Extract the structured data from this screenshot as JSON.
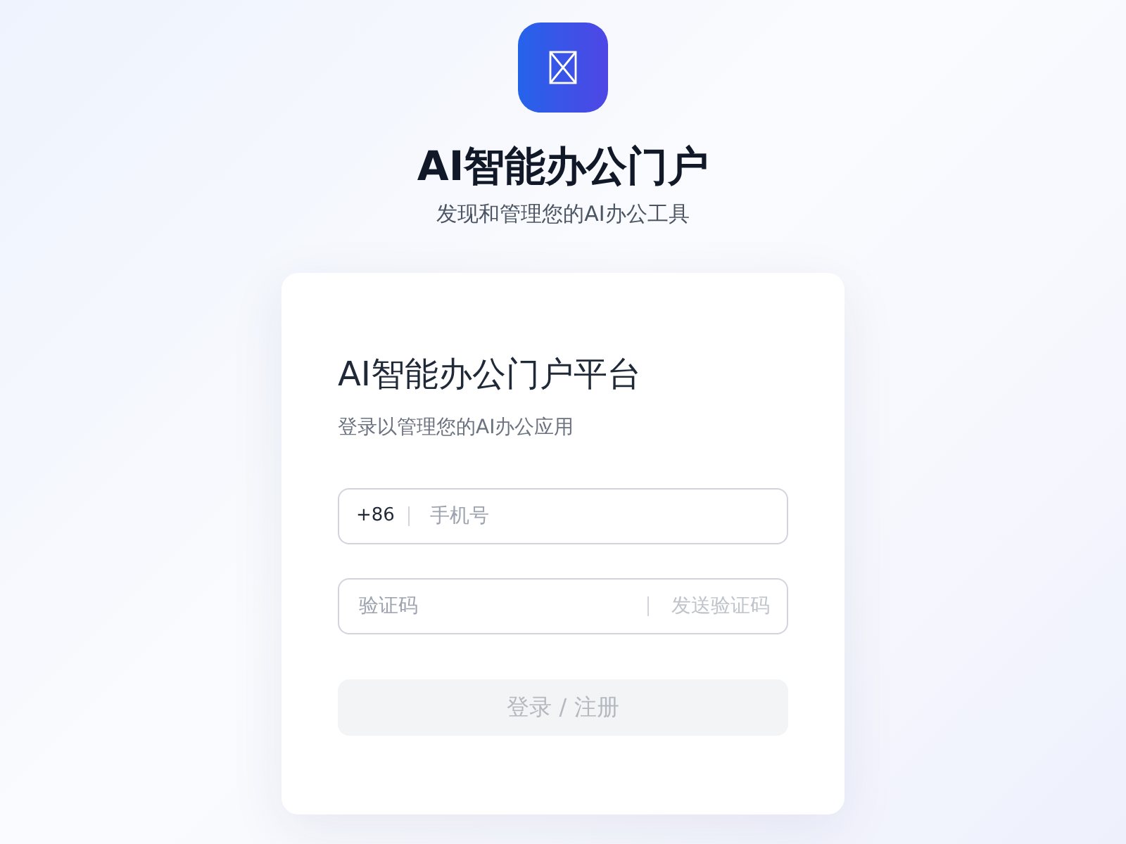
{
  "header": {
    "title": "AI智能办公门户",
    "subtitle": "发现和管理您的AI办公工具"
  },
  "card": {
    "title": "AI智能办公门户平台",
    "subtitle": "登录以管理您的AI办公应用",
    "phone": {
      "prefix": "+86",
      "placeholder": "手机号"
    },
    "code": {
      "placeholder": "验证码",
      "send_button": {
        "label": "发送验证码",
        "disabled": true
      }
    },
    "submit": {
      "label": "登录 / 注册",
      "disabled": true
    }
  }
}
